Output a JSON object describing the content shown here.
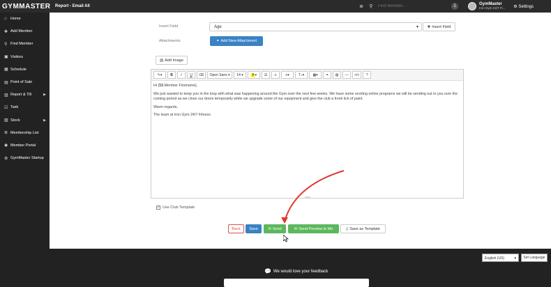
{
  "topbar": {
    "logo": "GYMMASTER",
    "title": "Report - Email All",
    "search_placeholder": "Find Member...",
    "notifications": "1",
    "user_name": "GymMaster",
    "user_gym": "Iron Gym 24/7 Fi...",
    "settings_label": "Settings"
  },
  "sidebar": {
    "items": [
      {
        "label": "Home",
        "icon": "home-icon",
        "glyph": "⌂"
      },
      {
        "label": "Add Member",
        "icon": "plus-icon",
        "glyph": "✚"
      },
      {
        "label": "Find Member",
        "icon": "search-icon",
        "glyph": "⚲"
      },
      {
        "label": "Visitors",
        "icon": "visitors-icon",
        "glyph": "▣"
      },
      {
        "label": "Schedule",
        "icon": "calendar-icon",
        "glyph": "▦"
      },
      {
        "label": "Point of Sale",
        "icon": "cart-icon",
        "glyph": "▤"
      },
      {
        "label": "Report & Till",
        "icon": "report-icon",
        "glyph": "▥",
        "caret": true
      },
      {
        "label": "Task",
        "icon": "check-icon",
        "glyph": "☑"
      },
      {
        "label": "Stock",
        "icon": "stock-icon",
        "glyph": "▧",
        "caret": true
      },
      {
        "label": "Membership List",
        "icon": "list-icon",
        "glyph": "≣"
      },
      {
        "label": "Member Portal",
        "icon": "globe-icon",
        "glyph": "◉"
      },
      {
        "label": "GymMaster Startup",
        "icon": "settings-icon",
        "glyph": "⚙"
      }
    ]
  },
  "form": {
    "insert_field_label": "Insert Field",
    "insert_field_value": "Age",
    "insert_field_button": "Insert Field",
    "attachments_label": "Attachments",
    "add_attachment_button": "Add New Attachment",
    "add_image_button": "Add Image"
  },
  "editor": {
    "toolbar": {
      "font": "Open Sans",
      "size": "14"
    },
    "body": [
      "Hi {$$:Member Firstname},",
      "We just wanted to keep you in the loop with what was happening around the Gym over the next few weeks. We have some exciting online programs we will be sending out to you over the coming period as we close our doors temporarily while we upgrade some of our equipment and give the club a fresh lick of paint.",
      "Warm regards,",
      "The team at Iron Gym 24/7 Fitness"
    ]
  },
  "options": {
    "use_club_template": "Use Club Template"
  },
  "actions": {
    "back": "Back",
    "save": "Save",
    "send": "Send",
    "send_preview": "Send Preview to Me",
    "save_template": "Save as Template"
  },
  "footer": {
    "language": "English (US)",
    "set_language": "Set Language",
    "feedback": "We would love your feedback"
  },
  "colors": {
    "primary": "#3a82c4",
    "success": "#5cb85c",
    "danger": "#d9534f",
    "sidebar": "#222222",
    "arrow": "#e03a2a"
  }
}
